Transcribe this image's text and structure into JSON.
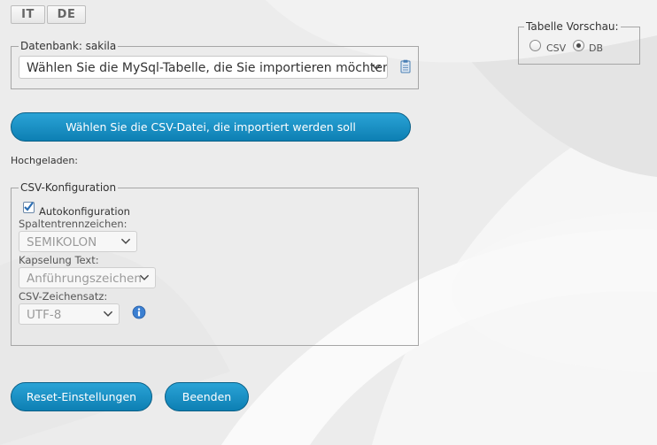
{
  "lang": {
    "it": "IT",
    "de": "DE"
  },
  "preview": {
    "legend": "Tabelle Vorschau:",
    "csv": "CSV",
    "db": "DB",
    "selected": "DB"
  },
  "database": {
    "legend": "Datenbank: sakila",
    "table_select": "Wählen Sie die MySql-Tabelle, die Sie importieren möchten",
    "action_icon": "clipboard-icon"
  },
  "upload": {
    "button": "Wählen Sie die CSV-Datei, die importiert werden soll",
    "uploaded_label": "Hochgeladen:"
  },
  "csv_config": {
    "legend": "CSV-Konfiguration",
    "auto_label": "Autokonfiguration",
    "auto_checked": true,
    "separator_label": "Spaltentrennzeichen:",
    "separator_value": "SEMIKOLON",
    "enclosure_label": "Kapselung Text:",
    "enclosure_value": "Anführungszeichen",
    "charset_label": "CSV-Zeichensatz:",
    "charset_value": "UTF-8",
    "info_icon": "info-icon"
  },
  "footer": {
    "reset": "Reset-Einstellungen",
    "exit": "Beenden"
  },
  "colors": {
    "accent": "#1a90c4",
    "accent_dark": "#0a5f86",
    "background": "#eeeeee",
    "info": "#3b7fd1"
  }
}
